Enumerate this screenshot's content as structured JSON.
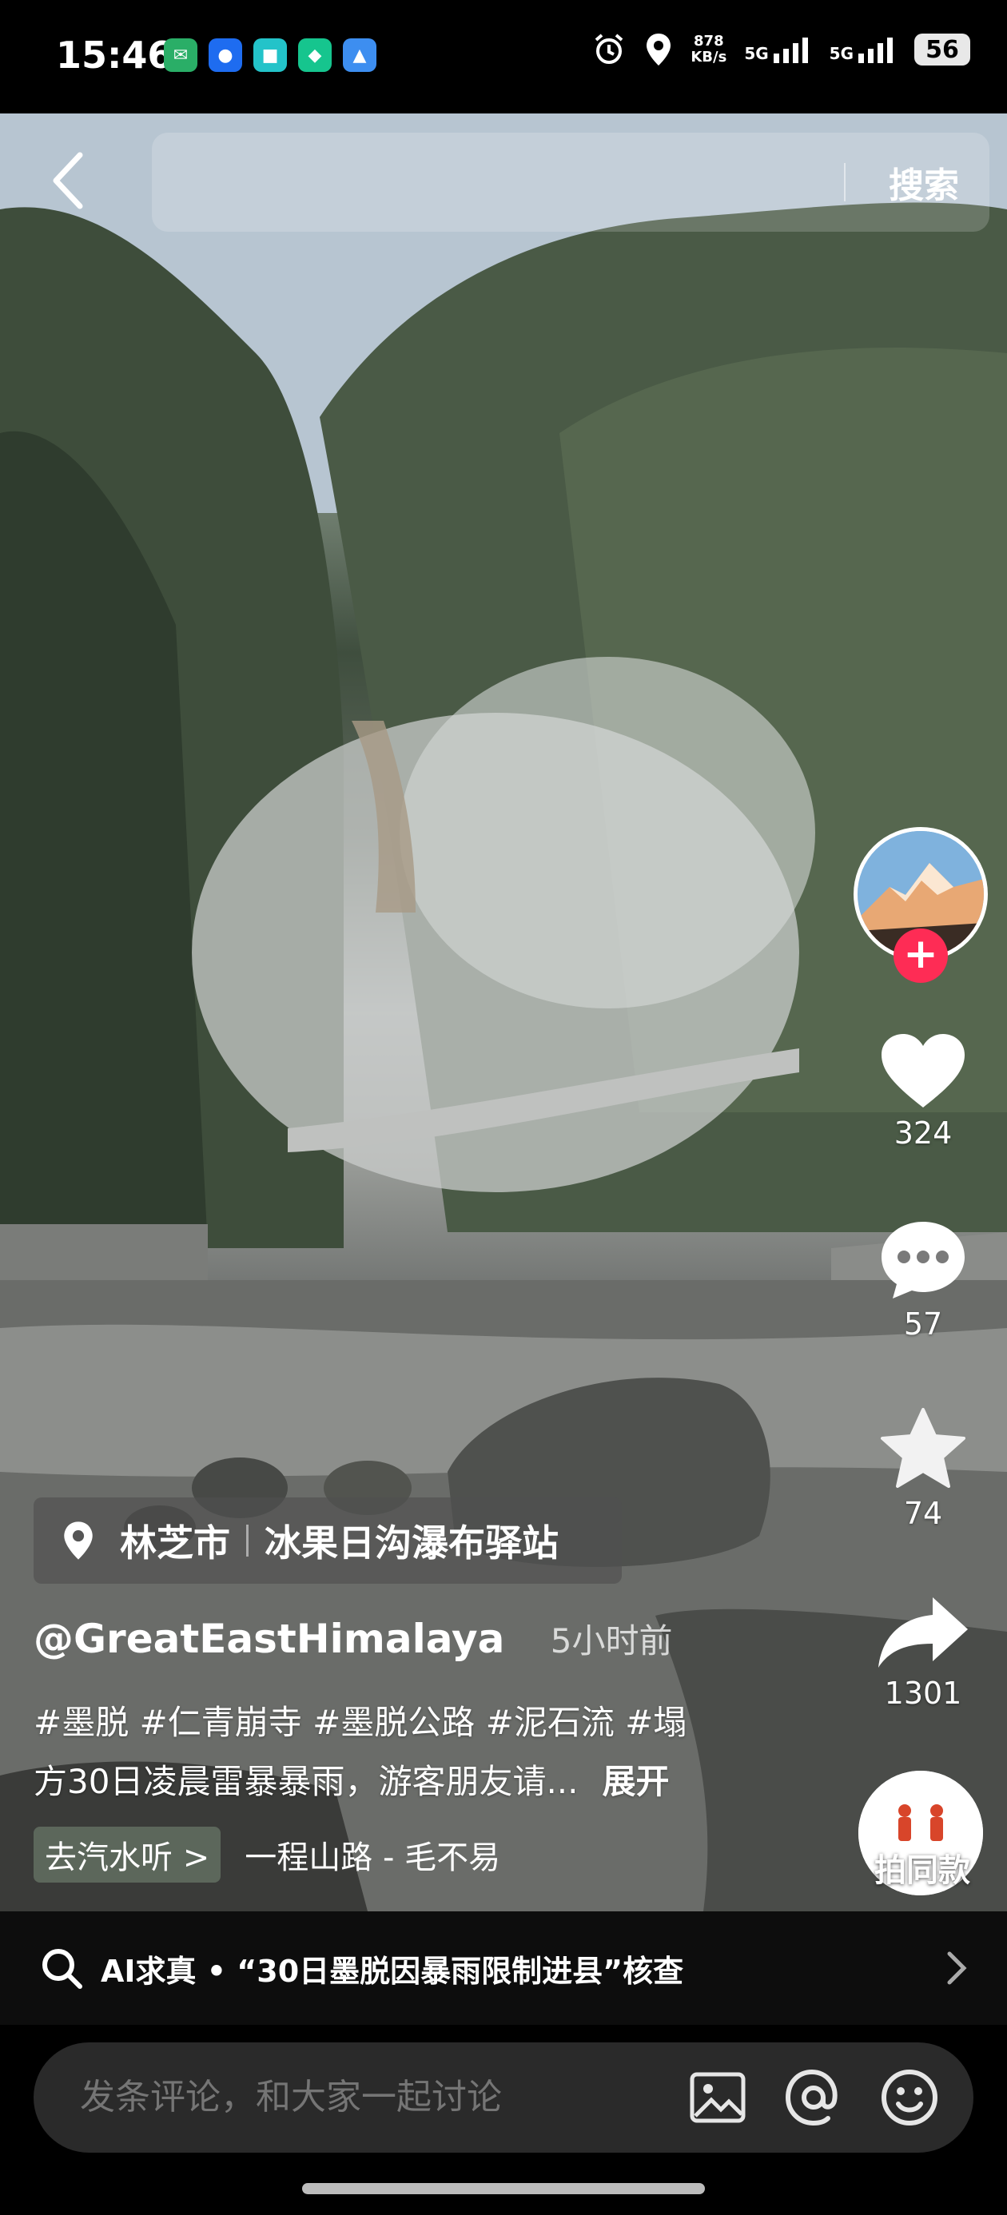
{
  "status_bar": {
    "time": "15:46",
    "net_speed_value": "878",
    "net_speed_unit": "KB/s",
    "net_type_1": "5G",
    "net_type_2": "5G",
    "battery": "56"
  },
  "header": {
    "search_label": "搜索",
    "back_icon": "chevron-left-icon"
  },
  "right_rail": {
    "follow_icon": "plus-icon",
    "like_count": "324",
    "comment_count": "57",
    "favorite_count": "74",
    "share_count": "1301",
    "same_style_label": "拍同款"
  },
  "caption": {
    "location_city": "林芝市",
    "location_place": "冰果日沟瀑布驿站",
    "author": "@GreatEastHimalaya",
    "post_time": "5小时前",
    "line1": "#墨脱 #仁青崩寺 #墨脱公路 #泥石流 #塌",
    "line2": "方30日凌晨雷暴暴雨，游客朋友请...",
    "expand_label": "展开",
    "music_chip": "去汽水听 >",
    "music_title": "一程山路 - 毛不易"
  },
  "ai_check": {
    "text": "AI求真 • “30日墨脱因暴雨限制进县”核查"
  },
  "comment_bar": {
    "placeholder": "发条评论，和大家一起讨论"
  },
  "colors": {
    "accent_red": "#fe2c55",
    "background": "#000000"
  }
}
